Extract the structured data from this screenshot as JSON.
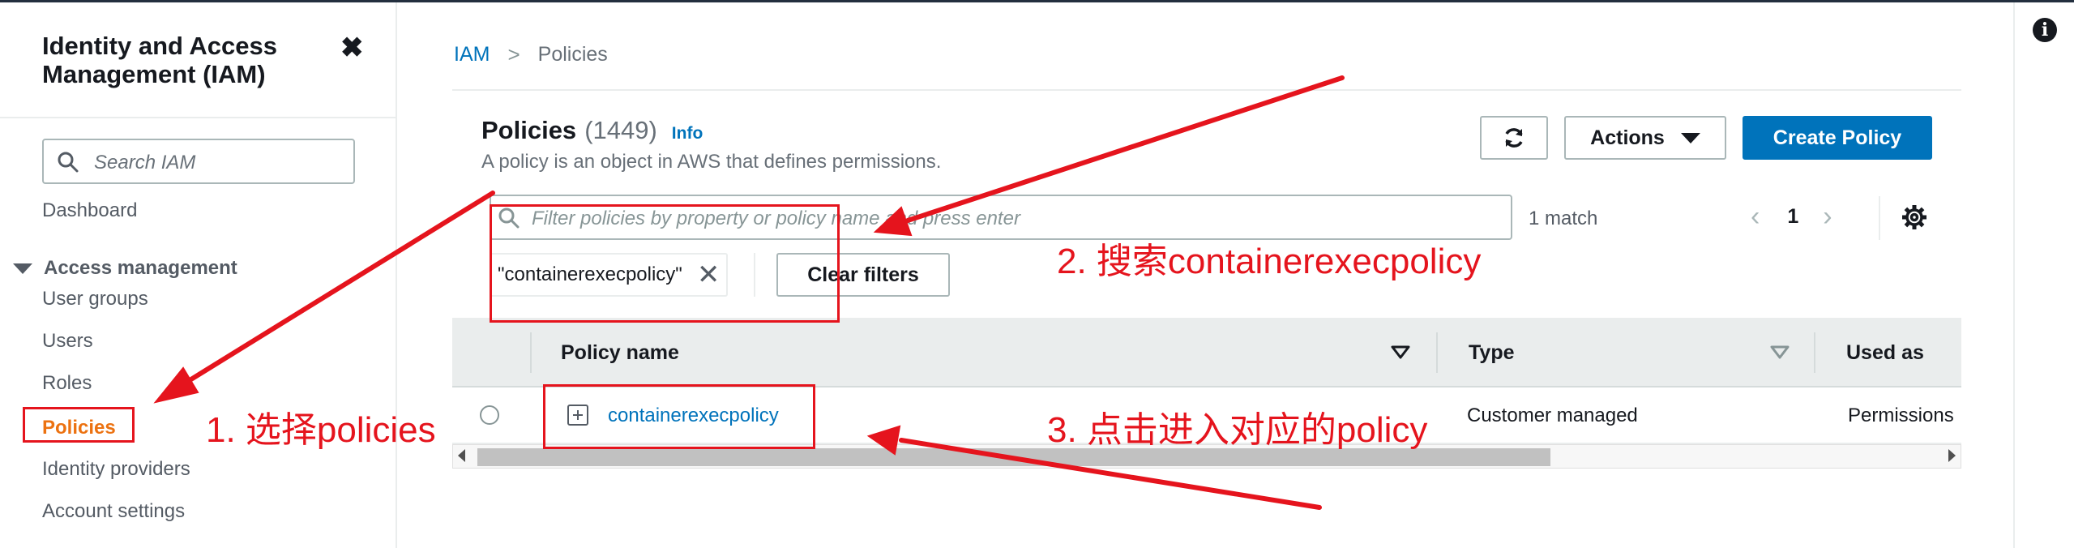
{
  "sidebar": {
    "title": "Identity and Access Management (IAM)",
    "close_glyph": "✖",
    "search_placeholder": "Search IAM",
    "dashboard": "Dashboard",
    "section": "Access management",
    "items": [
      "User groups",
      "Users",
      "Roles",
      "Policies",
      "Identity providers",
      "Account settings"
    ],
    "active_item": "Policies"
  },
  "breadcrumb": {
    "root": "IAM",
    "separator": ">",
    "current": "Policies"
  },
  "panel": {
    "title": "Policies",
    "count": "(1449)",
    "info": "Info",
    "description": "A policy is an object in AWS that defines permissions.",
    "actions_label": "Actions",
    "create_label": "Create Policy"
  },
  "filter": {
    "placeholder": "Filter policies by property or policy name and press enter",
    "match_text": "1 match",
    "page": "1",
    "token": "\"containerexecpolicy\"",
    "clear_label": "Clear filters"
  },
  "table": {
    "columns": [
      "Policy name",
      "Type",
      "Used as"
    ],
    "rows": [
      {
        "name": "containerexecpolicy",
        "type": "Customer managed",
        "used_as": "Permissions"
      }
    ]
  },
  "annotations": {
    "step1": "1. 选择policies",
    "step2": "2. 搜索containerexecpolicy",
    "step3": "3. 点击进入对应的policy"
  },
  "colors": {
    "accent": "#0073bb",
    "active_nav": "#ec7211",
    "annotation_red": "#e5141d"
  },
  "icons": [
    "close-icon",
    "search-icon",
    "refresh-icon",
    "caret-down-icon",
    "chevron-left-icon",
    "chevron-right-icon",
    "gear-icon",
    "remove-token-icon",
    "sort-icon",
    "expand-icon",
    "info-icon"
  ]
}
